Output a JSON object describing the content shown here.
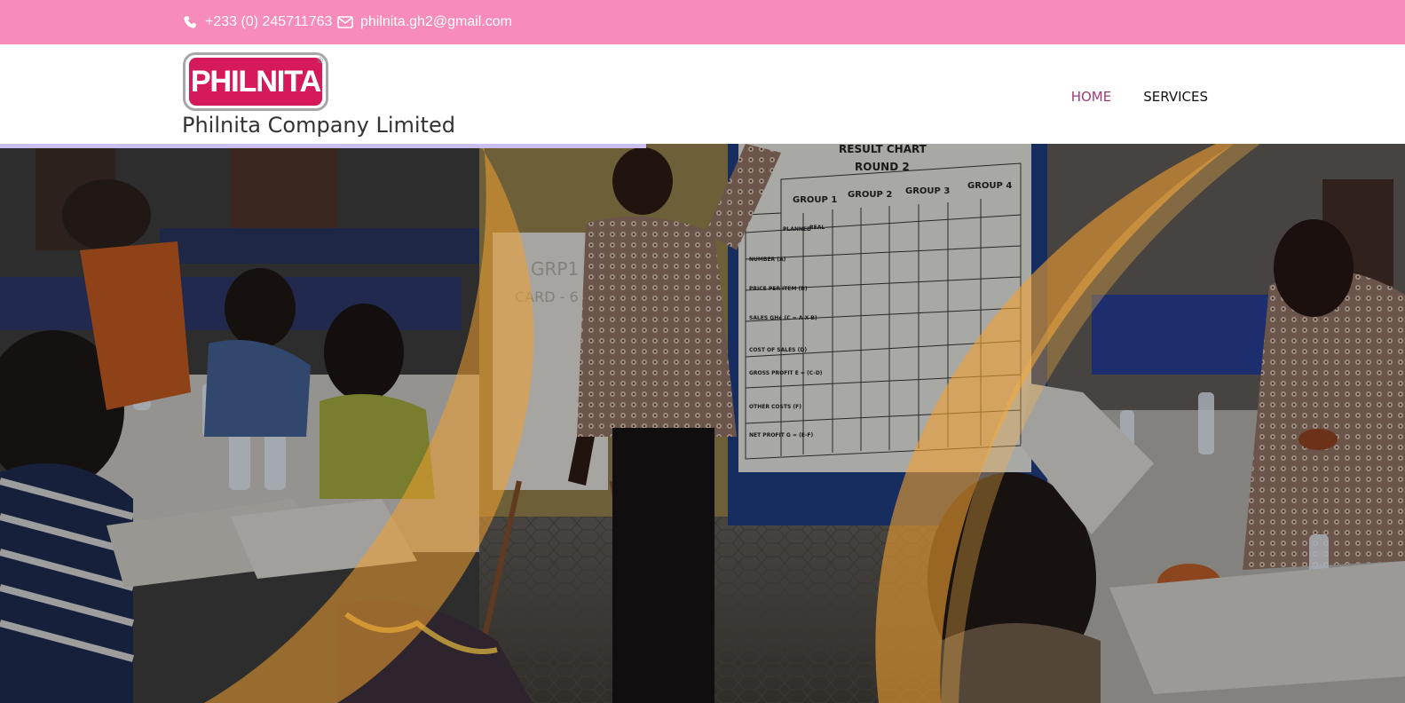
{
  "topbar": {
    "phone": "+233 (0) 245711763",
    "email": "philnita.gh2@gmail.com",
    "phone_icon": "phone-icon",
    "email_icon": "envelope-icon",
    "background": "#f78bb9"
  },
  "header": {
    "logo_text": "PHILNITA",
    "logo_mark": "®",
    "company_name": "Philnita Company Limited"
  },
  "nav": {
    "items": [
      {
        "label": "HOME",
        "active": true
      },
      {
        "label": "SERVICES",
        "active": false
      }
    ],
    "active_color": "#9a3c74"
  },
  "slider": {
    "progress": 0.46,
    "progress_color": "#c9bff2"
  },
  "hero": {
    "chart_title": "RESULT CHART",
    "round": "ROUND 2",
    "groups": [
      "GROUP 1",
      "GROUP 2",
      "GROUP 3",
      "GROUP 4"
    ],
    "subcols": [
      "PLANNED",
      "REAL"
    ],
    "rows": [
      "NUMBER (A)",
      "PRICE PER ITEM (B)",
      "SALES GH¢ (C = A X B)",
      "COST OF SALES (D)",
      "GROSS PROFIT E = (C-D)",
      "OTHER COSTS (F)",
      "NET PROFIT G = (E-F)"
    ],
    "flipchart_text_1": "GRP1",
    "flipchart_text_2": "CARD - 6",
    "accent": "#f0a030"
  }
}
